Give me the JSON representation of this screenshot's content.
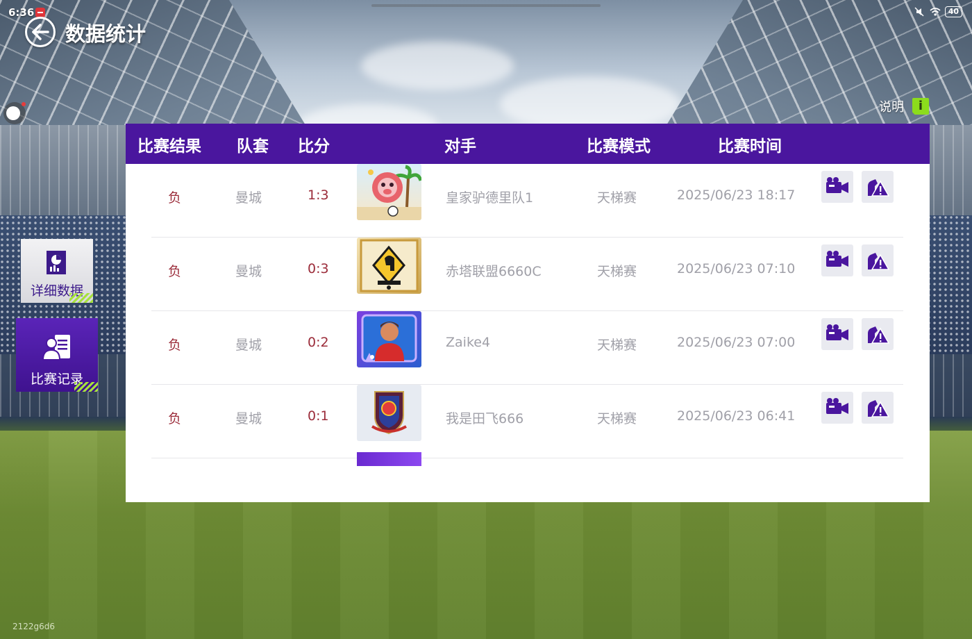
{
  "status_bar": {
    "time": "6:36",
    "icons": [
      "mute-icon",
      "wifi-icon",
      "battery-icon"
    ],
    "battery": "40"
  },
  "header": {
    "title": "数据统计",
    "help_label": "说明",
    "help_icon_text": "i"
  },
  "tabs": [
    {
      "label": "详细数据",
      "icon": "chart-report-icon",
      "active": false
    },
    {
      "label": "比赛记录",
      "icon": "clipboard-person-icon",
      "active": true
    }
  ],
  "table": {
    "columns": [
      "比赛结果",
      "队套",
      "比分",
      "对手",
      "比赛模式",
      "比赛时间"
    ],
    "rows": [
      {
        "result": "负",
        "kit": "曼城",
        "score": "1:3",
        "opponent": "皇家驴德里队1",
        "mode": "天梯赛",
        "time": "2025/06/23 18:17",
        "badge": "beach-pig-badge"
      },
      {
        "result": "负",
        "kit": "曼城",
        "score": "0:3",
        "opponent": "赤塔联盟6660C",
        "mode": "天梯赛",
        "time": "2025/06/23 07:10",
        "badge": "spartan-helmet-badge"
      },
      {
        "result": "负",
        "kit": "曼城",
        "score": "0:2",
        "opponent": "Zaike4",
        "mode": "天梯赛",
        "time": "2025/06/23 07:00",
        "badge": "player-portrait-badge"
      },
      {
        "result": "负",
        "kit": "曼城",
        "score": "0:1",
        "opponent": "我是田飞666",
        "mode": "天梯赛",
        "time": "2025/06/23 06:41",
        "badge": "club-crest-badge"
      }
    ]
  },
  "footer": {
    "id": "2122g6d6"
  },
  "colors": {
    "header_purple": "#4a169e",
    "loss_red": "#9b2c3a",
    "muted_text": "#a0a0a8",
    "accent_green": "#8cdc1c"
  }
}
